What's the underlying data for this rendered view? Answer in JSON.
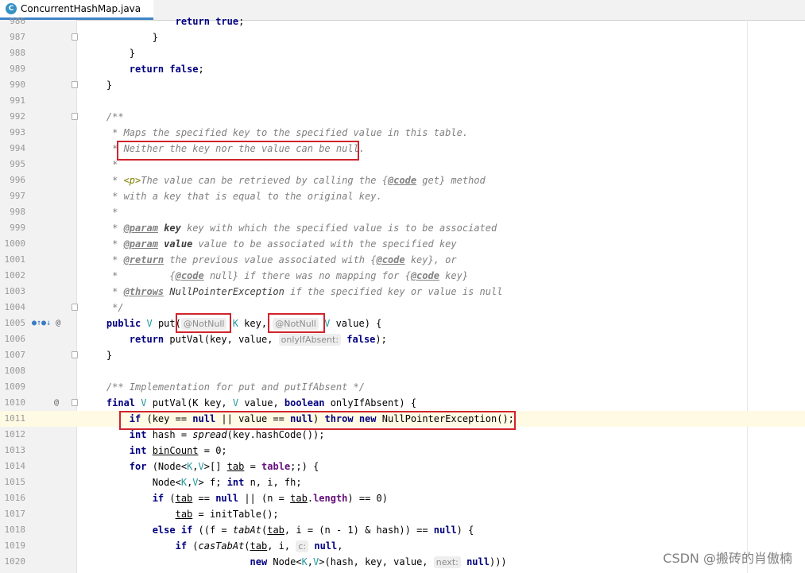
{
  "tab": {
    "label": "ConcurrentHashMap.java",
    "icon": "java-class-icon",
    "icon_letter": "C"
  },
  "gutter_icons": {
    "override_up": "override-icon",
    "implement": "implements-icon",
    "annotation": "@"
  },
  "lines": [
    {
      "n": "986",
      "text": "                return true;"
    },
    {
      "n": "987",
      "text": "            }"
    },
    {
      "n": "988",
      "text": "        }"
    },
    {
      "n": "989",
      "text": "        return false;"
    },
    {
      "n": "990",
      "text": "    }"
    },
    {
      "n": "991",
      "text": ""
    },
    {
      "n": "992",
      "text": "    /**"
    },
    {
      "n": "993",
      "text": "     * Maps the specified key to the specified value in this table."
    },
    {
      "n": "994",
      "text": "     * Neither the key nor the value can be null."
    },
    {
      "n": "995",
      "text": "     *"
    },
    {
      "n": "996",
      "text": "     * <p>The value can be retrieved by calling the {@code get} method"
    },
    {
      "n": "997",
      "text": "     * with a key that is equal to the original key."
    },
    {
      "n": "998",
      "text": "     *"
    },
    {
      "n": "999",
      "text": "     * @param key key with which the specified value is to be associated"
    },
    {
      "n": "1000",
      "text": "     * @param value value to be associated with the specified key"
    },
    {
      "n": "1001",
      "text": "     * @return the previous value associated with {@code key}, or"
    },
    {
      "n": "1002",
      "text": "     *         {@code null} if there was no mapping for {@code key}"
    },
    {
      "n": "1003",
      "text": "     * @throws NullPointerException if the specified key or value is null"
    },
    {
      "n": "1004",
      "text": "     */"
    },
    {
      "n": "1005",
      "text": "    public V put(@NotNull K key, @NotNull V value) {"
    },
    {
      "n": "1006",
      "text": "        return putVal(key, value, onlyIfAbsent: false);"
    },
    {
      "n": "1007",
      "text": "    }"
    },
    {
      "n": "1008",
      "text": ""
    },
    {
      "n": "1009",
      "text": "    /** Implementation for put and putIfAbsent */"
    },
    {
      "n": "1010",
      "text": "    final V putVal(K key, V value, boolean onlyIfAbsent) {"
    },
    {
      "n": "1011",
      "text": "        if (key == null || value == null) throw new NullPointerException();"
    },
    {
      "n": "1012",
      "text": "        int hash = spread(key.hashCode());"
    },
    {
      "n": "1013",
      "text": "        int binCount = 0;"
    },
    {
      "n": "1014",
      "text": "        for (Node<K,V>[] tab = table;;) {"
    },
    {
      "n": "1015",
      "text": "            Node<K,V> f; int n, i, fh;"
    },
    {
      "n": "1016",
      "text": "            if (tab == null || (n = tab.length) == 0)"
    },
    {
      "n": "1017",
      "text": "                tab = initTable();"
    },
    {
      "n": "1018",
      "text": "            else if ((f = tabAt(tab, i = (n - 1) & hash)) == null) {"
    },
    {
      "n": "1019",
      "text": "                if (casTabAt(tab, i, c: null,"
    },
    {
      "n": "1020",
      "text": "                             new Node<K,V>(hash, key, value, next: null)))"
    }
  ],
  "tokens": {
    "return": "return",
    "true": "true",
    "false": "false",
    "public": "public",
    "final": "final",
    "boolean": "boolean",
    "if": "if",
    "null": "null",
    "throw": "throw",
    "new": "new",
    "int": "int",
    "for": "for",
    "else": "else",
    "annotation": "@NotNull",
    "hint_only_if_absent": "onlyIfAbsent:",
    "hint_c": "c:",
    "hint_next": "next:",
    "at_param": "@param",
    "at_return": "@return",
    "at_throws": "@throws",
    "at_code": "@code",
    "p_tag": "<p>"
  },
  "watermark": "CSDN @搬砖的肖傲楠",
  "colors": {
    "keyword": "#000080",
    "comment": "#808080",
    "type_param": "#20999d",
    "field": "#660e7a",
    "highlight_box": "#d0242c",
    "current_line": "#fffae3"
  }
}
